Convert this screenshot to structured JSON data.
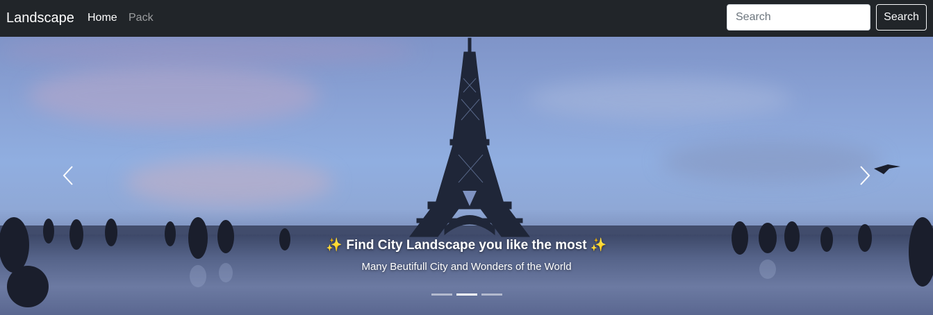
{
  "navbar": {
    "brand": "Landscape",
    "links": [
      {
        "label": "Home",
        "active": true
      },
      {
        "label": "Pack",
        "active": false
      }
    ],
    "search": {
      "placeholder": "Search",
      "value": "",
      "button_label": "Search"
    }
  },
  "carousel": {
    "caption": {
      "title": "✨ Find City Landscape you like the most ✨",
      "subtitle": "Many Beutifull City and Wonders of the World"
    },
    "slide_count": 3,
    "active_index": 1,
    "icons": {
      "prev": "chevron-left-icon",
      "next": "chevron-right-icon"
    }
  },
  "colors": {
    "navbar_bg": "#212529",
    "text_light": "#ffffff"
  }
}
